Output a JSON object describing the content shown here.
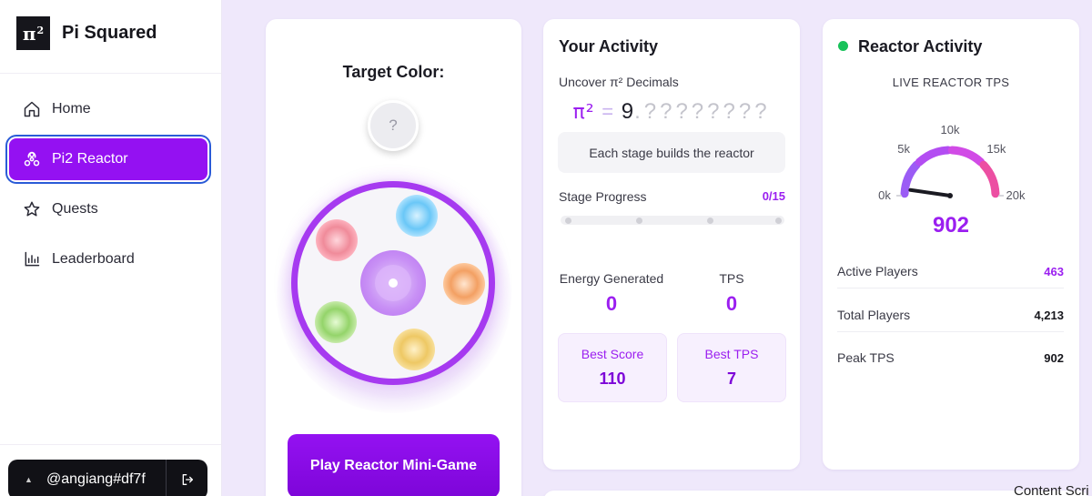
{
  "brand": {
    "logo_symbol": "π",
    "logo_exponent": "2",
    "name": "Pi Squared"
  },
  "sidebar": {
    "items": [
      {
        "label": "Home",
        "icon": "home-icon",
        "active": false
      },
      {
        "label": "Pi2 Reactor",
        "icon": "reactor-icon",
        "active": true
      },
      {
        "label": "Quests",
        "icon": "star-icon",
        "active": false
      },
      {
        "label": "Leaderboard",
        "icon": "bar-chart-icon",
        "active": false
      }
    ],
    "user": {
      "icon_glyph": "▲",
      "handle": "@angiang#df7f",
      "logout_glyph": "⇥"
    }
  },
  "game": {
    "target_title": "Target Color:",
    "target_unknown": "?",
    "play_button": "Play Reactor Mini-Game"
  },
  "activity": {
    "title": "Your Activity",
    "uncover_label": "Uncover π² Decimals",
    "pi_symbol": "π²",
    "equals": "=",
    "integer_part": "9",
    "decimal_point": ".",
    "hidden_decimals": "????????",
    "stage_note": "Each stage builds the reactor",
    "stage_label": "Stage Progress",
    "stage_value": "0/15",
    "stage_fraction": 0,
    "energy_label": "Energy Generated",
    "energy_value": "0",
    "tps_label": "TPS",
    "tps_value": "0",
    "best_score_label": "Best Score",
    "best_score_value": "110",
    "best_tps_label": "Best TPS",
    "best_tps_value": "7"
  },
  "reactor": {
    "title": "Reactor Activity",
    "live_label": "LIVE REACTOR TPS",
    "gauge": {
      "min": 0,
      "max": 20000,
      "value": 902,
      "ticks": [
        "0k",
        "5k",
        "10k",
        "15k",
        "20k"
      ]
    },
    "value_text": "902",
    "metrics": [
      {
        "label": "Active Players",
        "value": "463"
      },
      {
        "label": "Total Players",
        "value": "4,213"
      },
      {
        "label": "Peak TPS",
        "value": "902"
      }
    ],
    "status_color": "#18c25a"
  },
  "footer": {
    "content_scrim": "Content Scri"
  },
  "colors": {
    "accent": "#9b1ff0",
    "accent_dark": "#7d05d8",
    "background": "#efe8fb",
    "live": "#18c25a"
  }
}
